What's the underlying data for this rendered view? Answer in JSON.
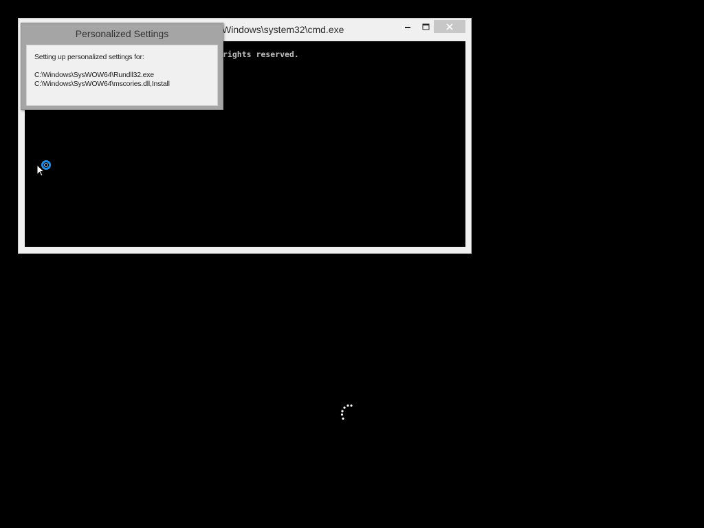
{
  "cmd_window": {
    "title": "Windows\\system32\\cmd.exe",
    "console_lines": [
      "rights reserved."
    ],
    "controls": {
      "minimize_icon": "minimize-icon",
      "maximize_icon": "maximize-icon",
      "close_icon": "close-icon"
    }
  },
  "dialog": {
    "title": "Personalized Settings",
    "heading": "Setting up personalized settings for:",
    "paths": [
      "C:\\Windows\\SysWOW64\\Rundll32.exe",
      "C:\\Windows\\SysWOW64\\mscories.dll,Install"
    ]
  },
  "cursor": {
    "type": "busy-pointer-icon",
    "accent": "#1e8ce6"
  },
  "spinner": {
    "type": "loading-spinner-icon",
    "color": "#ffffff"
  },
  "colors": {
    "desktop": "#000000",
    "window_frame": "#f0f0f0",
    "dialog_frame": "#a5a5a5",
    "console_text": "#c0c0c0"
  }
}
